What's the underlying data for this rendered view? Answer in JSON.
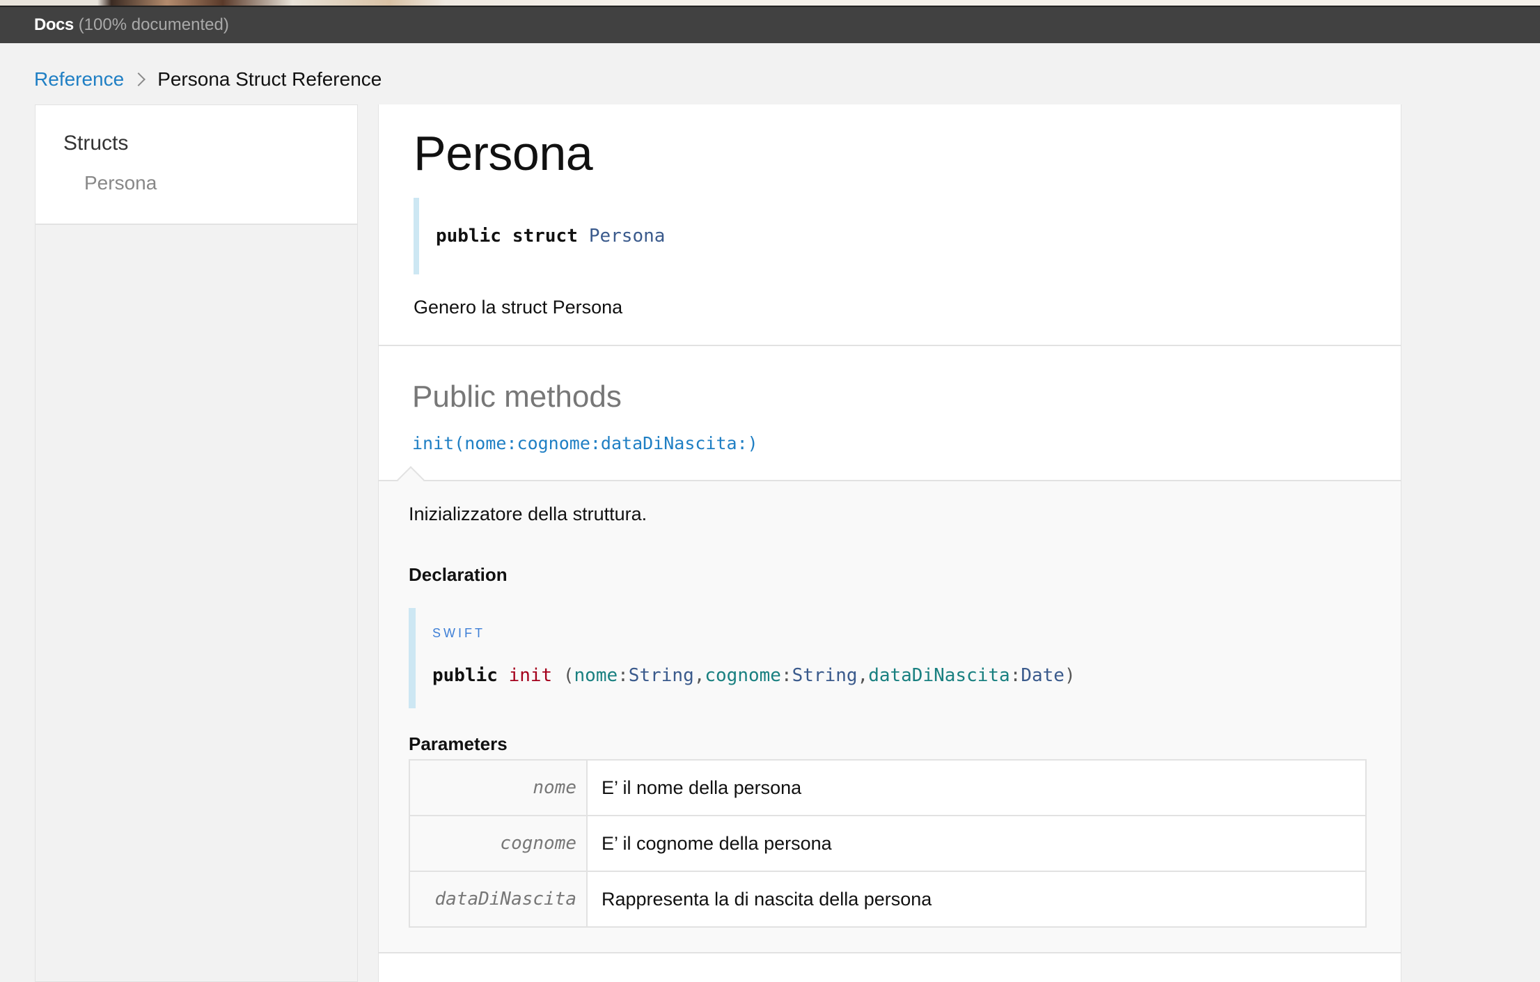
{
  "header": {
    "brand": "Docs",
    "coverage": "(100% documented)"
  },
  "breadcrumbs": {
    "root": "Reference",
    "current": "Persona Struct Reference"
  },
  "sidebar": {
    "group_title": "Structs",
    "items": [
      {
        "label": "Persona"
      }
    ]
  },
  "main": {
    "title": "Persona",
    "declaration": {
      "kw1": "public",
      "kw2": "struct",
      "type": "Persona"
    },
    "abstract": "Genero la struct Persona",
    "section_title": "Public methods",
    "method": {
      "link": "init(nome:cognome:dataDiNascita:)",
      "description": "Inizializzatore della struttura.",
      "declaration_heading": "Declaration",
      "language": "SWIFT",
      "code": {
        "kw": "public",
        "fn": "init",
        "open": " (",
        "p1": "nome",
        "c1": ":",
        "t1": "String",
        "s1": ",",
        "p2": "cognome",
        "c2": ":",
        "t2": "String",
        "s2": ",",
        "p3": "dataDiNascita",
        "c3": ":",
        "t3": "Date",
        "close": ")"
      },
      "parameters_heading": "Parameters",
      "parameters": [
        {
          "name": "nome",
          "description": "E’ il nome della persona"
        },
        {
          "name": "cognome",
          "description": "E’ il cognome della persona"
        },
        {
          "name": "dataDiNascita",
          "description": "Rappresenta la di nascita della persona"
        }
      ]
    }
  },
  "colors": {
    "header_bg": "#414141",
    "link": "#1f7fc4",
    "code_bar": "#cde7f3"
  }
}
